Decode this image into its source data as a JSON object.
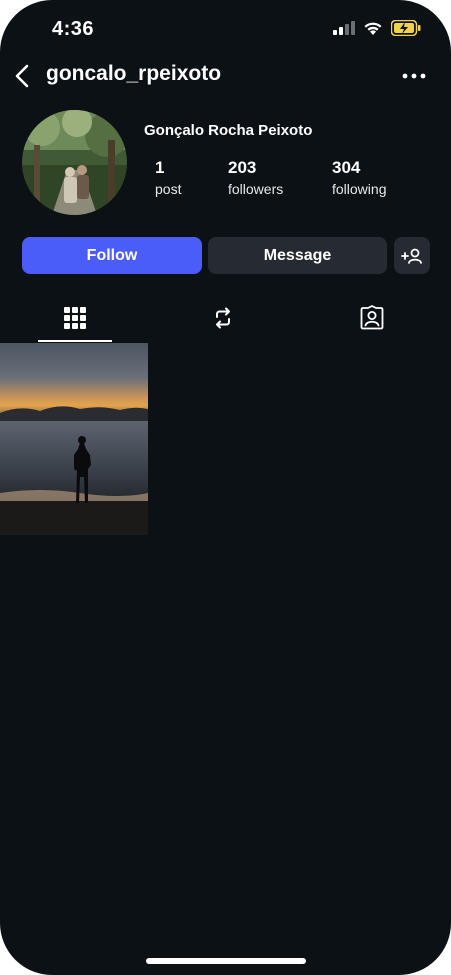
{
  "status_bar": {
    "time": "4:36",
    "signal_icon": "cellular-signal-icon",
    "wifi_icon": "wifi-icon",
    "battery_icon": "battery-charging-icon"
  },
  "header": {
    "username": "goncalo_rpeixoto",
    "back_icon": "chevron-left-icon",
    "more_icon": "more-horizontal-icon"
  },
  "profile": {
    "full_name": "Gonçalo Rocha Peixoto",
    "stats": [
      {
        "value": "1",
        "label": "post"
      },
      {
        "value": "203",
        "label": "followers"
      },
      {
        "value": "304",
        "label": "following"
      }
    ]
  },
  "actions": {
    "follow_label": "Follow",
    "message_label": "Message",
    "add_user_icon": "add-person-icon"
  },
  "tabs": [
    {
      "icon": "grid-icon",
      "selected": true
    },
    {
      "icon": "repost-icon",
      "selected": false
    },
    {
      "icon": "tagged-person-icon",
      "selected": false
    }
  ],
  "colors": {
    "background": "#0c1116",
    "accent": "#4a5df8",
    "secondary_button": "#262b33",
    "battery": "#f2d14b"
  }
}
